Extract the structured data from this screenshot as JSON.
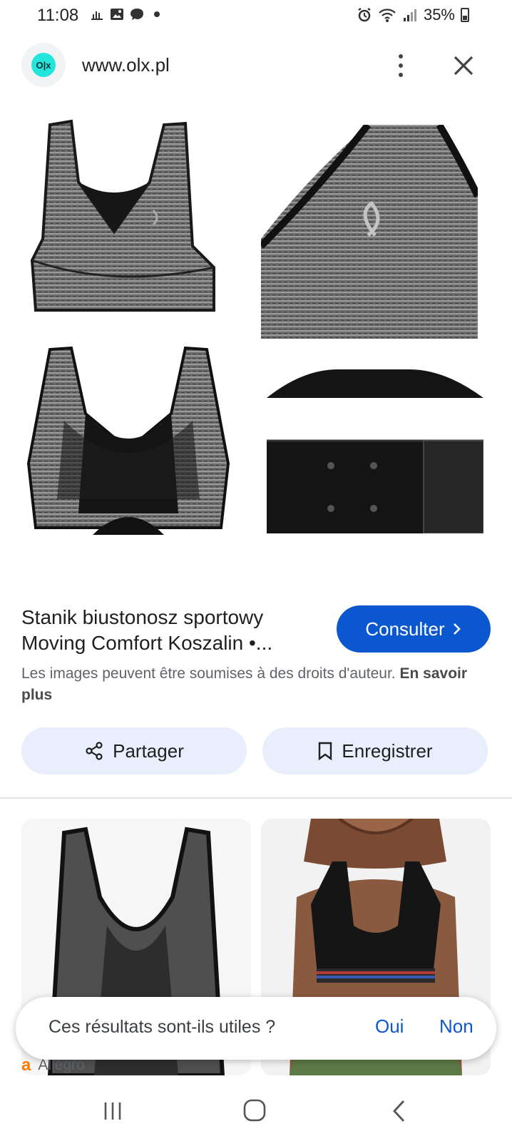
{
  "status_bar": {
    "time": "11:08",
    "battery": "35%",
    "left_icons": [
      "steam-notification-icon",
      "gallery-icon",
      "chat-icon",
      "dot-icon"
    ],
    "right_icons": [
      "alarm-icon",
      "wifi-icon",
      "signal-icon",
      "battery-icon"
    ]
  },
  "browser": {
    "favicon_text": "O|x",
    "url": "www.olx.pl"
  },
  "result": {
    "title_line1": "Stanik biustonosz sportowy",
    "title_line2": "Moving Comfort Koszalin •...",
    "consult_label": "Consulter",
    "copyright_text": "Les images peuvent être soumises à des droits d'auteur.",
    "learn_more": "En savoir plus"
  },
  "actions": {
    "share_label": "Partager",
    "save_label": "Enregistrer"
  },
  "related": {
    "left_source": "Allegro"
  },
  "feedback": {
    "question": "Ces résultats sont-ils utiles ?",
    "yes": "Oui",
    "no": "Non"
  },
  "colors": {
    "accent": "#0b57d0",
    "action_bg": "#e8eefb",
    "olx_teal": "#23e5db"
  }
}
